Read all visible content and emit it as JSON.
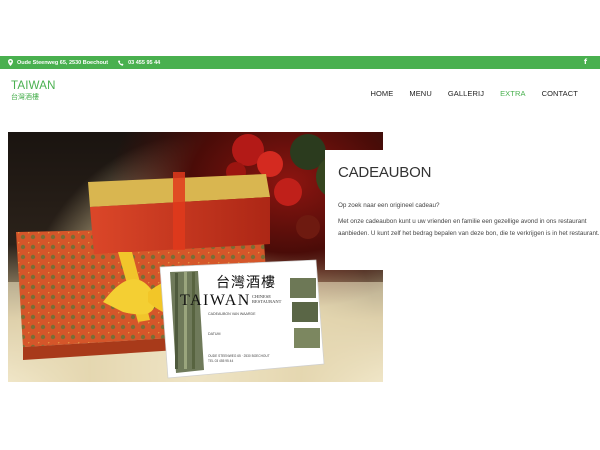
{
  "topbar": {
    "address": "Oude Steenweg 65, 2530 Boechout",
    "phone": "03 455 95 44",
    "social_icon": "facebook-icon",
    "facebook_glyph": "f"
  },
  "logo": {
    "line1": "TAIWAN",
    "line2": "台灣酒樓"
  },
  "nav": {
    "items": [
      {
        "label": "HOME"
      },
      {
        "label": "MENU"
      },
      {
        "label": "GALLERIJ"
      },
      {
        "label": "EXTRA",
        "active": true
      },
      {
        "label": "CONTACT"
      }
    ]
  },
  "hero": {
    "voucher": {
      "chinese": "台灣酒樓",
      "brand": "TAIWAN",
      "subtitle_line1": "CHINESE",
      "subtitle_line2": "RESTAURANT",
      "tagline": "CADEAUBON VAN WAARDE",
      "field_label": "DATUM",
      "footer_line1": "OUDE STEENWEG 65 · 2530 BOECHOUT",
      "footer_line2": "TEL 03 455 95 44"
    }
  },
  "content": {
    "title": "CADEAUBON",
    "paragraph1": "Op zoek naar een origineel cadeau?",
    "paragraph2": "Met onze cadeaubon kunt u uw vrienden en familie een gezellige avond in ons restaurant aanbieden. U kunt zelf het bedrag bepalen van deze bon, die te verkrijgen is in het restaurant."
  },
  "colors": {
    "accent": "#49b04f"
  }
}
